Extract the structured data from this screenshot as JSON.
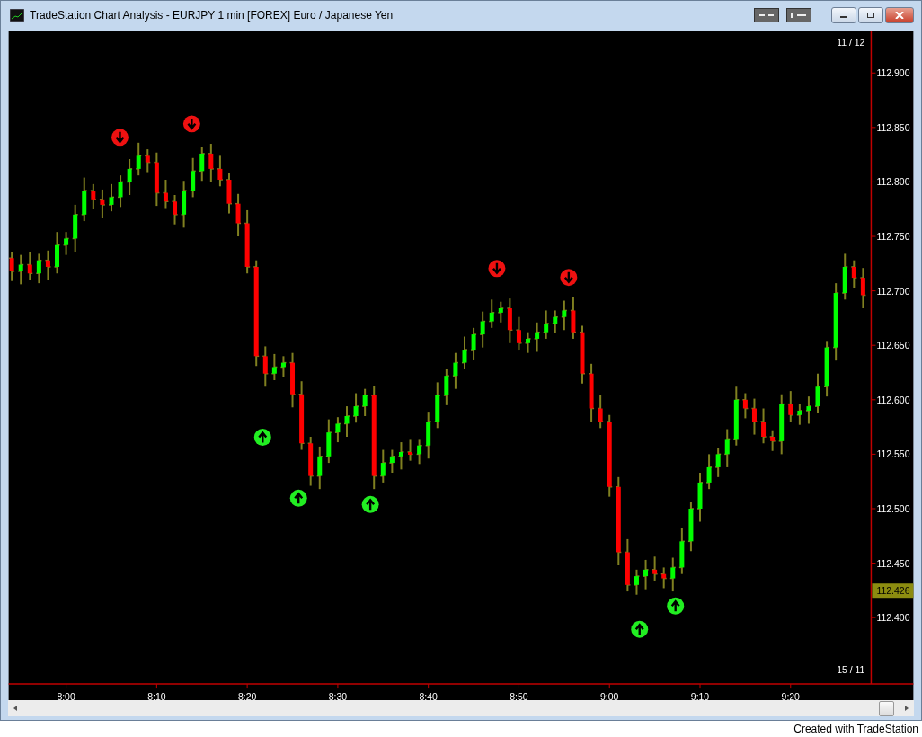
{
  "window": {
    "title": "TradeStation Chart Analysis - EURJPY 1 min [FOREX] Euro / Japanese Yen"
  },
  "chart": {
    "date_top": "11 / 12",
    "date_bottom": "15 / 11",
    "last_price": "112.426",
    "signals": [
      {
        "kind": "down"
      },
      {
        "kind": "down"
      },
      {
        "kind": "up"
      },
      {
        "kind": "up"
      },
      {
        "kind": "up"
      },
      {
        "kind": "down"
      },
      {
        "kind": "down"
      },
      {
        "kind": "up"
      },
      {
        "kind": "up"
      }
    ],
    "chart_data": {
      "type": "candlestick",
      "categories": [
        null,
        null,
        null,
        null,
        null,
        null,
        "8:00",
        null,
        null,
        null,
        null,
        null,
        null,
        null,
        null,
        null,
        "8:10",
        null,
        null,
        null,
        null,
        null,
        null,
        null,
        null,
        null,
        "8:20",
        null,
        null,
        null,
        null,
        null,
        null,
        null,
        null,
        null,
        "8:30",
        null,
        null,
        null,
        null,
        null,
        null,
        null,
        null,
        null,
        "8:40",
        null,
        null,
        null,
        null,
        null,
        null,
        null,
        null,
        null,
        "8:50",
        null,
        null,
        null,
        null,
        null,
        null,
        null,
        null,
        null,
        "9:00",
        null,
        null,
        null,
        null,
        null,
        null,
        null,
        null,
        null,
        "9:10",
        null,
        null,
        null,
        null,
        null,
        null,
        null,
        null,
        null,
        "9:20",
        null,
        null,
        null,
        null,
        null,
        null,
        null,
        null
      ],
      "ylim": [
        112.339,
        112.939
      ],
      "ohlc": [
        [
          112.73,
          112.736,
          112.709,
          112.718
        ],
        [
          112.718,
          112.733,
          112.706,
          112.724
        ],
        [
          112.724,
          112.736,
          112.71,
          112.716
        ],
        [
          112.716,
          112.734,
          112.707,
          112.728
        ],
        [
          112.728,
          112.737,
          112.71,
          112.722
        ],
        [
          112.722,
          112.754,
          112.716,
          112.742
        ],
        [
          112.742,
          112.754,
          112.733,
          112.748
        ],
        [
          112.748,
          112.779,
          112.736,
          112.77
        ],
        [
          112.77,
          112.804,
          112.764,
          112.792
        ],
        [
          112.792,
          112.798,
          112.775,
          112.784
        ],
        [
          112.784,
          112.793,
          112.767,
          112.779
        ],
        [
          112.779,
          112.798,
          112.773,
          112.786
        ],
        [
          112.786,
          112.806,
          112.777,
          112.8
        ],
        [
          112.8,
          112.821,
          112.788,
          112.812
        ],
        [
          112.812,
          112.836,
          112.806,
          112.824
        ],
        [
          112.824,
          112.83,
          112.809,
          112.818
        ],
        [
          112.818,
          112.827,
          112.778,
          112.79
        ],
        [
          112.79,
          112.802,
          112.776,
          112.782
        ],
        [
          112.782,
          112.788,
          112.761,
          112.77
        ],
        [
          112.77,
          112.801,
          112.758,
          112.792
        ],
        [
          112.792,
          112.822,
          112.786,
          112.81
        ],
        [
          112.81,
          112.832,
          112.801,
          112.826
        ],
        [
          112.826,
          112.835,
          112.8,
          112.812
        ],
        [
          112.812,
          112.824,
          112.796,
          112.802
        ],
        [
          112.802,
          112.808,
          112.771,
          112.78
        ],
        [
          112.78,
          112.789,
          112.75,
          112.762
        ],
        [
          112.762,
          112.774,
          112.716,
          112.722
        ],
        [
          112.722,
          112.728,
          112.631,
          112.64
        ],
        [
          112.64,
          112.649,
          112.612,
          112.624
        ],
        [
          112.624,
          112.642,
          112.618,
          112.63
        ],
        [
          112.63,
          112.64,
          112.621,
          112.634
        ],
        [
          112.634,
          112.643,
          112.593,
          112.605
        ],
        [
          112.605,
          112.617,
          112.554,
          112.56
        ],
        [
          112.56,
          112.566,
          112.521,
          112.53
        ],
        [
          112.53,
          112.557,
          112.518,
          112.548
        ],
        [
          112.548,
          112.582,
          112.542,
          112.57
        ],
        [
          112.57,
          112.584,
          112.561,
          112.578
        ],
        [
          112.578,
          112.594,
          112.566,
          112.585
        ],
        [
          112.585,
          112.606,
          112.579,
          112.594
        ],
        [
          112.594,
          112.61,
          112.585,
          112.604
        ],
        [
          112.604,
          112.613,
          112.518,
          112.53
        ],
        [
          112.53,
          112.554,
          112.524,
          112.542
        ],
        [
          112.542,
          112.554,
          112.533,
          112.548
        ],
        [
          112.548,
          112.561,
          112.536,
          112.552
        ],
        [
          112.552,
          112.564,
          112.544,
          112.55
        ],
        [
          112.55,
          112.564,
          112.541,
          112.558
        ],
        [
          112.558,
          112.589,
          112.546,
          112.58
        ],
        [
          112.58,
          112.616,
          112.574,
          112.604
        ],
        [
          112.604,
          112.628,
          112.595,
          112.622
        ],
        [
          112.622,
          112.643,
          112.61,
          112.634
        ],
        [
          112.634,
          112.658,
          112.628,
          112.646
        ],
        [
          112.646,
          112.666,
          112.637,
          112.66
        ],
        [
          112.66,
          112.681,
          112.648,
          112.672
        ],
        [
          112.672,
          112.692,
          112.666,
          112.68
        ],
        [
          112.68,
          112.69,
          112.671,
          112.684
        ],
        [
          112.684,
          112.693,
          112.652,
          112.664
        ],
        [
          112.664,
          112.676,
          112.646,
          112.652
        ],
        [
          112.652,
          112.662,
          112.643,
          112.656
        ],
        [
          112.656,
          112.671,
          112.644,
          112.662
        ],
        [
          112.662,
          112.682,
          112.656,
          112.67
        ],
        [
          112.67,
          112.682,
          112.661,
          112.676
        ],
        [
          112.676,
          112.691,
          112.664,
          112.682
        ],
        [
          112.682,
          112.694,
          112.656,
          112.662
        ],
        [
          112.662,
          112.668,
          112.615,
          112.624
        ],
        [
          112.624,
          112.633,
          112.58,
          112.592
        ],
        [
          112.592,
          112.604,
          112.574,
          112.58
        ],
        [
          112.58,
          112.586,
          112.511,
          112.52
        ],
        [
          112.52,
          112.529,
          112.448,
          112.46
        ],
        [
          112.46,
          112.472,
          112.424,
          112.43
        ],
        [
          112.43,
          112.444,
          112.421,
          112.438
        ],
        [
          112.438,
          112.453,
          112.426,
          112.444
        ],
        [
          112.444,
          112.456,
          112.434,
          112.44
        ],
        [
          112.44,
          112.446,
          112.427,
          112.436
        ],
        [
          112.436,
          112.455,
          112.424,
          112.446
        ],
        [
          112.446,
          112.482,
          112.44,
          112.47
        ],
        [
          112.47,
          112.506,
          112.461,
          112.5
        ],
        [
          112.5,
          112.533,
          112.488,
          112.524
        ],
        [
          112.524,
          112.55,
          112.518,
          112.538
        ],
        [
          112.538,
          112.556,
          112.529,
          112.55
        ],
        [
          112.55,
          112.573,
          112.538,
          112.564
        ],
        [
          112.564,
          112.612,
          112.558,
          112.6
        ],
        [
          112.6,
          112.606,
          112.583,
          112.592
        ],
        [
          112.592,
          112.601,
          112.568,
          112.58
        ],
        [
          112.58,
          112.592,
          112.56,
          112.566
        ],
        [
          112.566,
          112.572,
          112.553,
          112.562
        ],
        [
          112.562,
          112.605,
          112.55,
          112.596
        ],
        [
          112.596,
          112.608,
          112.58,
          112.586
        ],
        [
          112.586,
          112.596,
          112.577,
          112.59
        ],
        [
          112.59,
          112.603,
          112.578,
          112.594
        ],
        [
          112.594,
          112.624,
          112.588,
          112.612
        ],
        [
          112.612,
          112.654,
          112.603,
          112.648
        ],
        [
          112.648,
          112.707,
          112.636,
          112.698
        ],
        [
          112.698,
          112.734,
          112.692,
          112.722
        ],
        [
          112.722,
          112.728,
          112.703,
          112.712
        ],
        [
          112.712,
          112.721,
          112.684,
          112.696
        ]
      ],
      "yticks": [
        {
          "value": 112.9,
          "label": "112.900"
        },
        {
          "value": 112.85,
          "label": "112.850"
        },
        {
          "value": 112.8,
          "label": "112.800"
        },
        {
          "value": 112.75,
          "label": "112.750"
        },
        {
          "value": 112.7,
          "label": "112.700"
        },
        {
          "value": 112.65,
          "label": "112.650"
        },
        {
          "value": 112.6,
          "label": "112.600"
        },
        {
          "value": 112.55,
          "label": "112.550"
        },
        {
          "value": 112.5,
          "label": "112.500"
        },
        {
          "value": 112.45,
          "label": "112.450"
        },
        {
          "value": 112.4,
          "label": "112.400"
        }
      ]
    }
  },
  "footer": "Created with TradeStation"
}
